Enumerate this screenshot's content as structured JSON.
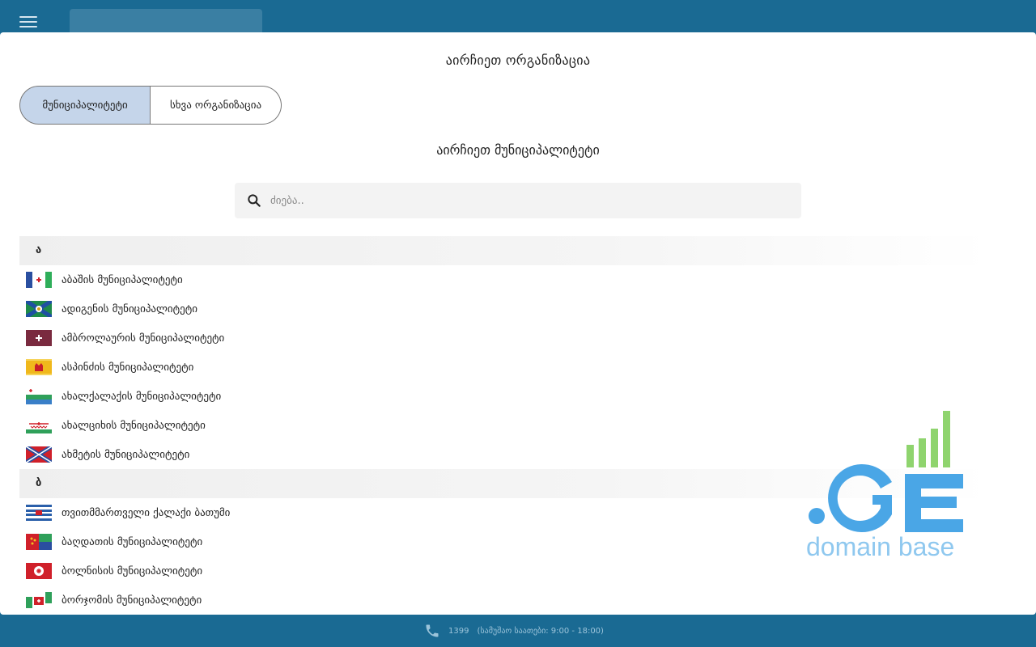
{
  "header": {
    "menu_icon": "hamburger-menu-icon"
  },
  "modal": {
    "title": "აირჩიეთ ორგანიზაცია",
    "tabs": [
      {
        "label": "მუნიციპალიტეტი",
        "active": true
      },
      {
        "label": "სხვა ორგანიზაცია",
        "active": false
      }
    ],
    "subtitle": "აირჩიეთ მუნიციპალიტეტი",
    "search": {
      "placeholder": "ძიება..",
      "value": "",
      "icon": "search-icon"
    },
    "groups": [
      {
        "letter": "ა",
        "items": [
          {
            "label": "აბაშის მუნიციპალიტეტი",
            "flag": "abasha"
          },
          {
            "label": "ადიგენის მუნიციპალიტეტი",
            "flag": "adigeni"
          },
          {
            "label": "ამბროლაურის მუნიციპალიტეტი",
            "flag": "ambrolauri"
          },
          {
            "label": "ასპინძის მუნიციპალიტეტი",
            "flag": "aspindza"
          },
          {
            "label": "ახალქალაქის მუნიციპალიტეტი",
            "flag": "akhalkalaki"
          },
          {
            "label": "ახალციხის მუნიციპალიტეტი",
            "flag": "akhaltsikhe"
          },
          {
            "label": "ახმეტის მუნიციპალიტეტი",
            "flag": "akhmeta"
          }
        ]
      },
      {
        "letter": "ბ",
        "items": [
          {
            "label": "თვითმმართველი ქალაქი ბათუმი",
            "flag": "batumi"
          },
          {
            "label": "ბაღდათის მუნიციპალიტეტი",
            "flag": "baghdati"
          },
          {
            "label": "ბოლნისის მუნიციპალიტეტი",
            "flag": "bolnisi"
          },
          {
            "label": "ბორჯომის მუნიციპალიტეტი",
            "flag": "borjomi"
          }
        ]
      }
    ]
  },
  "logo": {
    "text": "domain base",
    "colors": {
      "blue": "#4aa6e6",
      "green": "#8fd46e",
      "light_blue": "#8fc8ef"
    }
  },
  "footer": {
    "phone_icon": "phone-icon",
    "phone": "1399",
    "hours": "(სამუშაო საათები: 9:00 - 18:00)"
  },
  "colors": {
    "background": "#1a6a93",
    "active_tab": "#c5d5ea",
    "search_bg": "#f3f3f3"
  }
}
